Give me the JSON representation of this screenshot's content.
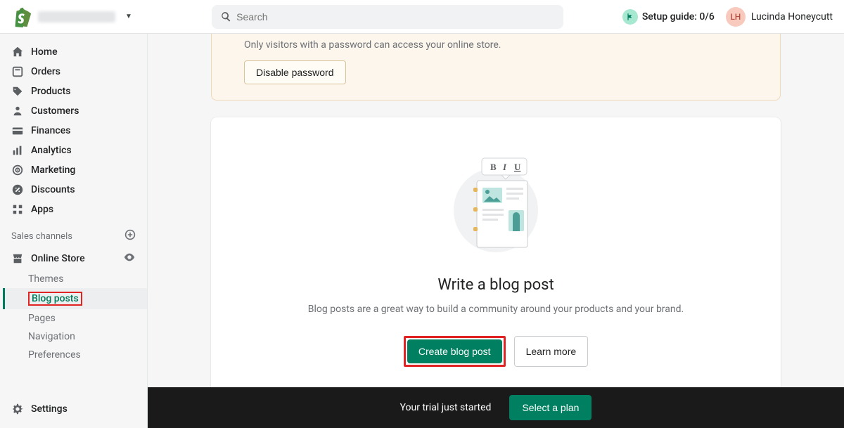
{
  "header": {
    "search_placeholder": "Search",
    "setup_guide_label": "Setup guide: 0/6",
    "user_initials": "LH",
    "user_name": "Lucinda Honeycutt"
  },
  "sidebar": {
    "items": [
      {
        "label": "Home"
      },
      {
        "label": "Orders"
      },
      {
        "label": "Products"
      },
      {
        "label": "Customers"
      },
      {
        "label": "Finances"
      },
      {
        "label": "Analytics"
      },
      {
        "label": "Marketing"
      },
      {
        "label": "Discounts"
      },
      {
        "label": "Apps"
      }
    ],
    "channels_label": "Sales channels",
    "online_store_label": "Online Store",
    "subitems": [
      {
        "label": "Themes"
      },
      {
        "label": "Blog posts"
      },
      {
        "label": "Pages"
      },
      {
        "label": "Navigation"
      },
      {
        "label": "Preferences"
      }
    ],
    "settings_label": "Settings"
  },
  "banner": {
    "text": "Only visitors with a password can access your online store.",
    "button": "Disable password"
  },
  "card": {
    "title": "Write a blog post",
    "subtitle": "Blog posts are a great way to build a community around your products and your brand.",
    "primary": "Create blog post",
    "secondary": "Learn more"
  },
  "trial": {
    "message": "Your trial just started",
    "button": "Select a plan"
  }
}
